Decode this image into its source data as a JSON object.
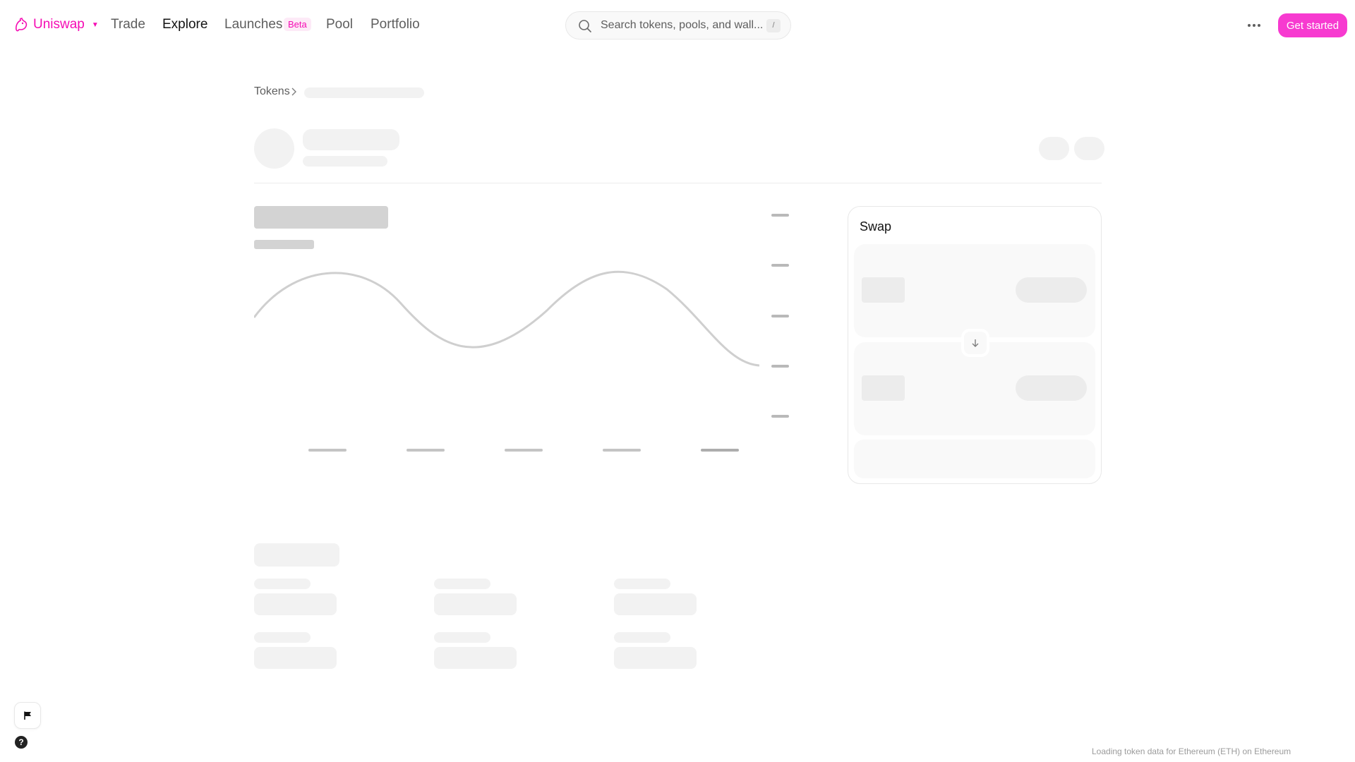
{
  "nav": {
    "brand": "Uniswap",
    "links": [
      "Trade",
      "Explore",
      "Launches",
      "Pool",
      "Portfolio"
    ],
    "active": "Explore",
    "beta_badge": "Beta",
    "search_placeholder": "Search tokens, pools, and wall...",
    "search_shortcut": "/",
    "cta_label": "Get started",
    "brand_color": "#f50db4",
    "cta_color": "#f73ad0"
  },
  "breadcrumb": {
    "root": "Tokens"
  },
  "swap": {
    "title": "Swap"
  },
  "status": {
    "text": "Loading token data for Ethereum (ETH) on Ethereum"
  },
  "icons": {
    "logo": "uniswap-unicorn-icon",
    "search": "search-icon",
    "more": "more-dots-icon",
    "breadcrumb_sep": "chevron-right-icon",
    "swap_direction": "arrow-down-icon",
    "feedback": "flag-icon",
    "help": "help-icon"
  }
}
